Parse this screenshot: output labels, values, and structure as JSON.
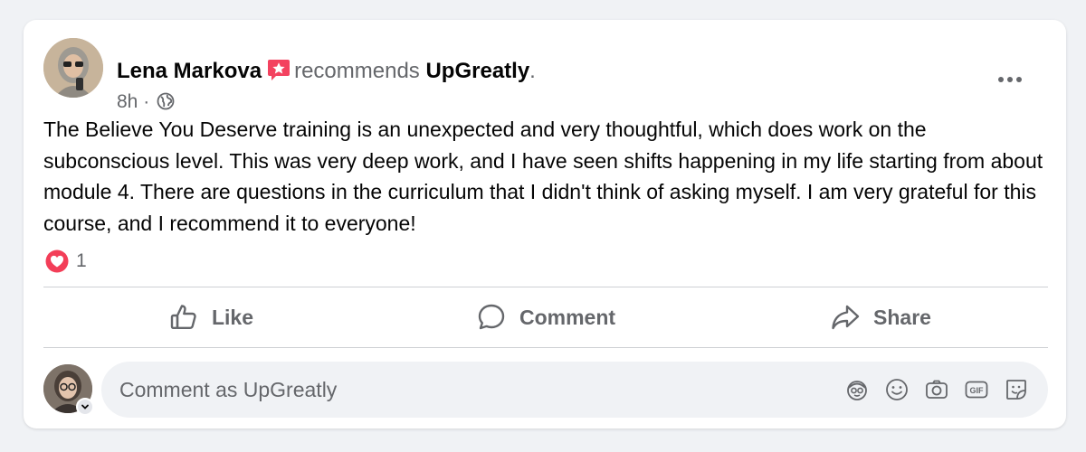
{
  "post": {
    "author": "Lena Markova",
    "verb": "recommends",
    "page": "UpGreatly",
    "punct": ".",
    "time": "8h",
    "separator": "·",
    "privacy_icon": "globe-icon",
    "text": "The Believe You Deserve training is an unexpected and very thoughtful, which does work on the subconscious level. This was very deep work, and I have seen shifts happening in my life starting from about module 4. There are questions in the curriculum that I didn't think of asking myself. I am very grateful for this course, and I recommend it to everyone!",
    "reaction_icon": "heart-icon",
    "reaction_count": "1"
  },
  "actions": {
    "like": "Like",
    "comment": "Comment",
    "share": "Share"
  },
  "composer": {
    "placeholder": "Comment as UpGreatly",
    "tools": [
      "avatar-sticker-icon",
      "emoji-icon",
      "camera-icon",
      "gif-icon",
      "sticker-icon"
    ]
  },
  "colors": {
    "accent_recommend": "#f3425f",
    "text_secondary": "#65676b",
    "background": "#f0f2f5"
  }
}
